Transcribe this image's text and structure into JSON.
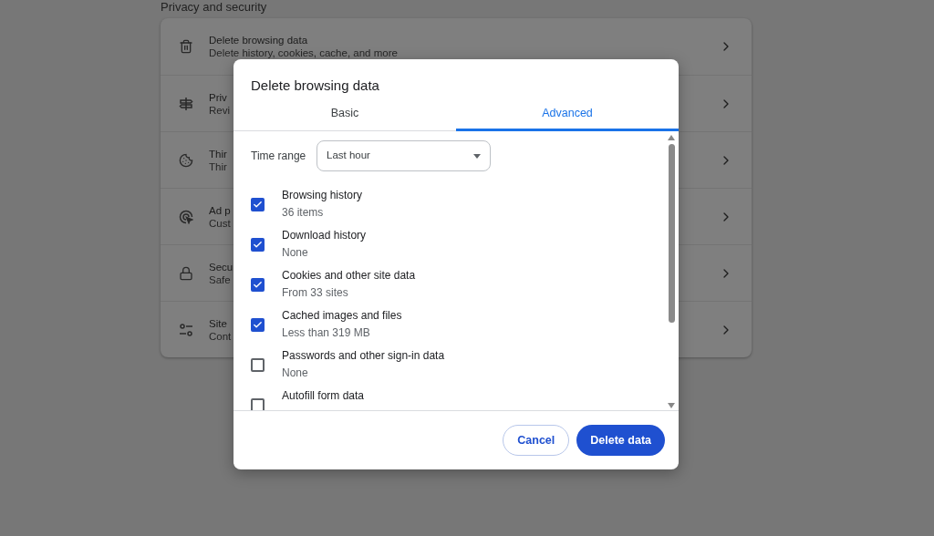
{
  "background": {
    "section_title": "Privacy and security",
    "rows": [
      {
        "title": "Delete browsing data",
        "subtitle": "Delete history, cookies, cache, and more"
      },
      {
        "title": "Priv",
        "subtitle": "Revi"
      },
      {
        "title": "Thir",
        "subtitle": "Thir"
      },
      {
        "title": "Ad p",
        "subtitle": "Cust"
      },
      {
        "title": "Secu",
        "subtitle": "Safe"
      },
      {
        "title": "Site",
        "subtitle": "Cont"
      }
    ]
  },
  "dialog": {
    "title": "Delete browsing data",
    "tabs": [
      {
        "label": "Basic",
        "selected": false
      },
      {
        "label": "Advanced",
        "selected": true
      }
    ],
    "time_range": {
      "label": "Time range",
      "value": "Last hour"
    },
    "items": [
      {
        "label": "Browsing history",
        "detail": "36 items",
        "checked": true
      },
      {
        "label": "Download history",
        "detail": "None",
        "checked": true
      },
      {
        "label": "Cookies and other site data",
        "detail": "From 33 sites",
        "checked": true
      },
      {
        "label": "Cached images and files",
        "detail": "Less than 319 MB",
        "checked": true
      },
      {
        "label": "Passwords and other sign-in data",
        "detail": "None",
        "checked": false
      },
      {
        "label": "Autofill form data",
        "checked": false
      }
    ],
    "buttons": [
      {
        "label": "Cancel",
        "kind": "secondary"
      },
      {
        "label": "Delete data",
        "kind": "primary"
      }
    ]
  }
}
